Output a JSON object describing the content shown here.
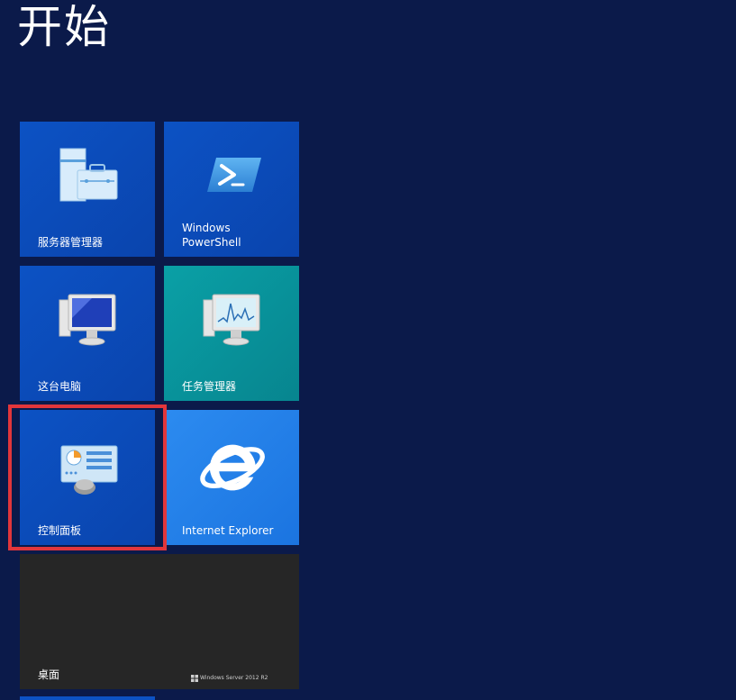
{
  "header": {
    "title": "开始"
  },
  "tiles": [
    {
      "id": "server-manager",
      "label": "服务器管理器",
      "icon": "server-manager-icon",
      "color": "#0c52c4"
    },
    {
      "id": "powershell",
      "label": "Windows\nPowerShell",
      "icon": "powershell-icon",
      "color": "#0c52c4"
    },
    {
      "id": "this-pc",
      "label": "这台电脑",
      "icon": "computer-icon",
      "color": "#0c52c4"
    },
    {
      "id": "task-manager",
      "label": "任务管理器",
      "icon": "task-manager-icon",
      "color": "#0aa0a6"
    },
    {
      "id": "control-panel",
      "label": "控制面板",
      "icon": "control-panel-icon",
      "color": "#0c52c4"
    },
    {
      "id": "internet-explorer",
      "label": "Internet Explorer",
      "icon": "internet-explorer-icon",
      "color": "#2c8bf0"
    },
    {
      "id": "desktop",
      "label": "桌面",
      "icon": "desktop-icon",
      "color": "#262626",
      "watermark": "Windows Server 2012 R2"
    }
  ],
  "highlight": {
    "target": "control-panel",
    "color": "#e2363b"
  },
  "colors": {
    "background": "#0b1a4a"
  }
}
